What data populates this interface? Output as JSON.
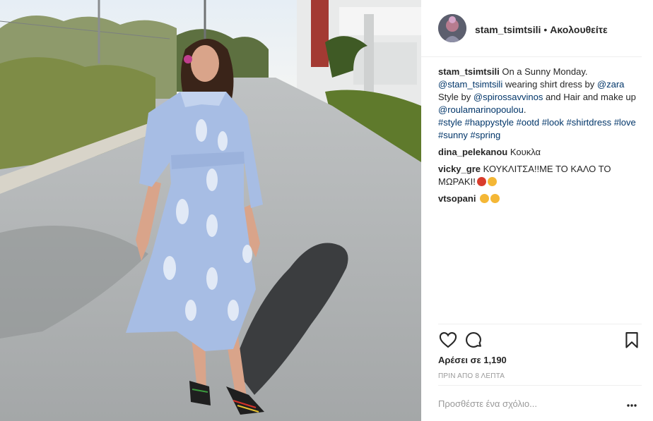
{
  "post": {
    "username": "stam_tsimtsili",
    "separator": "•",
    "follow_label": "Ακολουθείτε",
    "caption": {
      "username": "stam_tsimtsili",
      "text_1": "On a Sunny Monday.",
      "mention_self": "@stam_tsimtsili",
      "text_2": "wearing shirt dress by",
      "mention_zara": "@zara",
      "text_3": "Style by",
      "mention_style": "@spirossavvinos",
      "text_4": "and Hair and make up",
      "mention_hair": "@roulamarinopoulou",
      "text_5": ".",
      "hashtags": [
        "#style",
        "#happystyle",
        "#ootd",
        "#look",
        "#shirtdress",
        "#love",
        "#sunny",
        "#spring"
      ]
    },
    "comments": [
      {
        "username": "dina_pelekanou",
        "text": "Κουκλα"
      },
      {
        "username": "vicky_gre",
        "text": "ΚΟΥΚΛΙΤΣΑ!!ΜΕ ΤΟ ΚΑΛΟ ΤΟ ΜΩΡΑΚΙ!"
      },
      {
        "username": "vtsopani",
        "text": ""
      }
    ],
    "likes_label": "Αρέσει σε 1,190",
    "time_label": "ΠΡΙΝ ΑΠΟ 8 ΛΕΠΤΑ",
    "add_comment_placeholder": "Προσθέστε ένα σχόλιο...",
    "more_label": "..."
  },
  "icons": {
    "like": "heart-icon",
    "comment": "comment-icon",
    "save": "bookmark-icon",
    "more": "more-options-icon"
  },
  "colors": {
    "link": "#003569",
    "text": "#262626",
    "muted": "#999999",
    "divider": "#efefef",
    "dress": "#a7bde4"
  }
}
